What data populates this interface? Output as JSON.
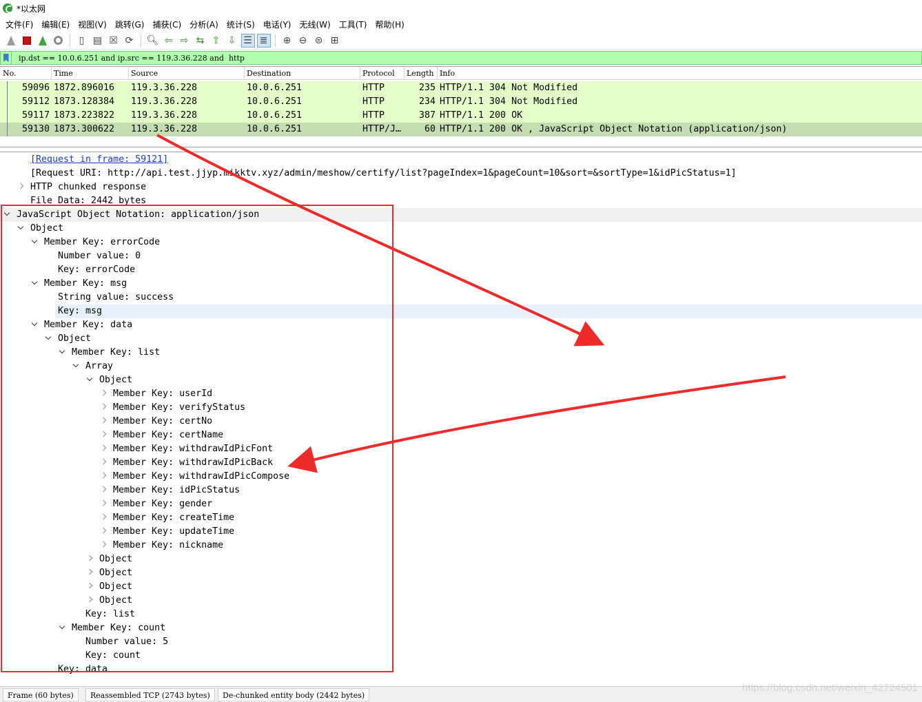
{
  "window": {
    "title": "*以太网"
  },
  "menu": [
    "文件(F)",
    "编辑(E)",
    "视图(V)",
    "跳转(G)",
    "捕获(C)",
    "分析(A)",
    "统计(S)",
    "电话(Y)",
    "无线(W)",
    "工具(T)",
    "帮助(H)"
  ],
  "toolbar": {
    "icons": [
      "start-capture-icon",
      "stop-capture-icon",
      "restart-capture-icon",
      "capture-options-icon",
      "open-file-icon",
      "save-file-icon",
      "close-file-icon",
      "reload-file-icon",
      "find-packet-icon",
      "go-back-icon",
      "go-forward-icon",
      "go-to-packet-icon",
      "go-first-icon",
      "go-last-icon",
      "auto-scroll-icon",
      "colorize-icon",
      "zoom-in-icon",
      "zoom-out-icon",
      "zoom-normal-icon",
      "resize-columns-icon"
    ]
  },
  "filter": {
    "value": "ip.dst == 10.0.6.251 and ip.src == 119.3.36.228 and  http",
    "color": "#afffaf"
  },
  "packet_list": {
    "columns": [
      "No.",
      "Time",
      "Source",
      "Destination",
      "Protocol",
      "Length",
      "Info"
    ],
    "rows": [
      {
        "no": "59096",
        "time": "1872.896016",
        "source": "119.3.36.228",
        "destination": "10.0.6.251",
        "protocol": "HTTP",
        "length": "235",
        "info": "HTTP/1.1 304 Not Modified"
      },
      {
        "no": "59112",
        "time": "1873.128384",
        "source": "119.3.36.228",
        "destination": "10.0.6.251",
        "protocol": "HTTP",
        "length": "234",
        "info": "HTTP/1.1 304 Not Modified"
      },
      {
        "no": "59117",
        "time": "1873.223822",
        "source": "119.3.36.228",
        "destination": "10.0.6.251",
        "protocol": "HTTP",
        "length": "387",
        "info": "HTTP/1.1 200 OK"
      },
      {
        "no": "59130",
        "time": "1873.300622",
        "source": "119.3.36.228",
        "destination": "10.0.6.251",
        "protocol": "HTTP/J…",
        "length": "60",
        "info": "HTTP/1.1 200 OK , JavaScript Object Notation (application/json)"
      }
    ],
    "row_color": "#e4ffc7",
    "selected_row_color": "#c5deb1"
  },
  "details": {
    "lines": [
      {
        "indent": 2,
        "toggle": "none",
        "text": "[Request in frame: 59121]",
        "link": true
      },
      {
        "indent": 2,
        "toggle": "none",
        "text": "[Request URI: http://api.test.jjyp.mikktv.xyz/admin/meshow/certify/list?pageIndex=1&pageCount=10&sort=&sortType=1&idPicStatus=1]"
      },
      {
        "indent": 2,
        "toggle": "collapsed",
        "text": "HTTP chunked response"
      },
      {
        "indent": 2,
        "toggle": "none",
        "text": "File Data: 2442 bytes"
      },
      {
        "indent": 1,
        "toggle": "expanded",
        "text": "JavaScript Object Notation: application/json",
        "highlight": true
      },
      {
        "indent": 2,
        "toggle": "expanded",
        "text": "Object"
      },
      {
        "indent": 3,
        "toggle": "expanded",
        "text": "Member Key: errorCode"
      },
      {
        "indent": 4,
        "toggle": "none",
        "text": "Number value: 0"
      },
      {
        "indent": 4,
        "toggle": "none",
        "text": "Key: errorCode"
      },
      {
        "indent": 3,
        "toggle": "expanded",
        "text": "Member Key: msg"
      },
      {
        "indent": 4,
        "toggle": "none",
        "text": "String value: success"
      },
      {
        "indent": 4,
        "toggle": "none",
        "text": "Key: msg",
        "selected": true
      },
      {
        "indent": 3,
        "toggle": "expanded",
        "text": "Member Key: data"
      },
      {
        "indent": 4,
        "toggle": "expanded",
        "text": "Object"
      },
      {
        "indent": 5,
        "toggle": "expanded",
        "text": "Member Key: list"
      },
      {
        "indent": 6,
        "toggle": "expanded",
        "text": "Array"
      },
      {
        "indent": 7,
        "toggle": "expanded",
        "text": "Object"
      },
      {
        "indent": 8,
        "toggle": "collapsed",
        "text": "Member Key: userId"
      },
      {
        "indent": 8,
        "toggle": "collapsed",
        "text": "Member Key: verifyStatus"
      },
      {
        "indent": 8,
        "toggle": "collapsed",
        "text": "Member Key: certNo"
      },
      {
        "indent": 8,
        "toggle": "collapsed",
        "text": "Member Key: certName"
      },
      {
        "indent": 8,
        "toggle": "collapsed",
        "text": "Member Key: withdrawIdPicFont"
      },
      {
        "indent": 8,
        "toggle": "collapsed",
        "text": "Member Key: withdrawIdPicBack"
      },
      {
        "indent": 8,
        "toggle": "collapsed",
        "text": "Member Key: withdrawIdPicCompose"
      },
      {
        "indent": 8,
        "toggle": "collapsed",
        "text": "Member Key: idPicStatus"
      },
      {
        "indent": 8,
        "toggle": "collapsed",
        "text": "Member Key: gender"
      },
      {
        "indent": 8,
        "toggle": "collapsed",
        "text": "Member Key: createTime"
      },
      {
        "indent": 8,
        "toggle": "collapsed",
        "text": "Member Key: updateTime"
      },
      {
        "indent": 8,
        "toggle": "collapsed",
        "text": "Member Key: nickname"
      },
      {
        "indent": 7,
        "toggle": "collapsed",
        "text": "Object"
      },
      {
        "indent": 7,
        "toggle": "collapsed",
        "text": "Object"
      },
      {
        "indent": 7,
        "toggle": "collapsed",
        "text": "Object"
      },
      {
        "indent": 7,
        "toggle": "collapsed",
        "text": "Object"
      },
      {
        "indent": 6,
        "toggle": "none",
        "text": "Key: list"
      },
      {
        "indent": 5,
        "toggle": "expanded",
        "text": "Member Key: count"
      },
      {
        "indent": 6,
        "toggle": "none",
        "text": "Number value: 5"
      },
      {
        "indent": 6,
        "toggle": "none",
        "text": "Key: count"
      },
      {
        "indent": 4,
        "toggle": "none",
        "text": "Key: data"
      }
    ]
  },
  "status_tabs": [
    "Frame (60 bytes)",
    "Reassembled TCP (2743 bytes)",
    "De-chunked entity body (2442 bytes)"
  ],
  "watermark": "https://blog.csdn.net/weixin_42724501",
  "annotation_color": "#ee2a2a"
}
